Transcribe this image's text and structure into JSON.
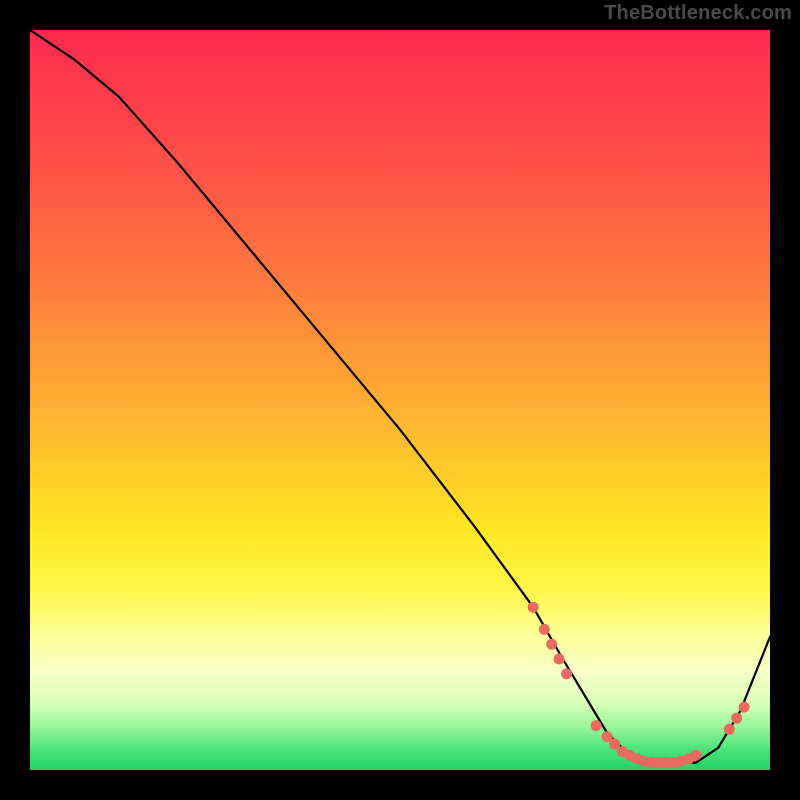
{
  "watermark": "TheBottleneck.com",
  "colors": {
    "curve": "#000000",
    "marker": "#e96a5f",
    "frame": "#000000"
  },
  "chart_data": {
    "type": "line",
    "title": "",
    "xlabel": "",
    "ylabel": "",
    "xlim": [
      0,
      100
    ],
    "ylim": [
      0,
      100
    ],
    "grid": false,
    "legend": false,
    "series": [
      {
        "name": "bottleneck-curve",
        "x": [
          0,
          6,
          12,
          20,
          30,
          40,
          50,
          60,
          68,
          72,
          75,
          78,
          81,
          84,
          87,
          90,
          93,
          96,
          100
        ],
        "y": [
          100,
          96,
          91,
          82,
          70,
          58,
          46,
          33,
          22,
          15,
          10,
          5,
          2,
          1,
          1,
          1,
          3,
          8,
          18
        ]
      }
    ],
    "markers": [
      {
        "x": 68.0,
        "y": 22.0
      },
      {
        "x": 69.5,
        "y": 19.0
      },
      {
        "x": 70.5,
        "y": 17.0
      },
      {
        "x": 71.5,
        "y": 15.0
      },
      {
        "x": 72.5,
        "y": 13.0
      },
      {
        "x": 76.5,
        "y": 6.0
      },
      {
        "x": 78.0,
        "y": 4.5
      },
      {
        "x": 79.0,
        "y": 3.5
      },
      {
        "x": 80.0,
        "y": 2.5
      },
      {
        "x": 81.0,
        "y": 2.0
      },
      {
        "x": 82.0,
        "y": 1.5
      },
      {
        "x": 83.0,
        "y": 1.2
      },
      {
        "x": 84.0,
        "y": 1.0
      },
      {
        "x": 85.0,
        "y": 1.0
      },
      {
        "x": 86.0,
        "y": 1.0
      },
      {
        "x": 87.0,
        "y": 1.0
      },
      {
        "x": 88.0,
        "y": 1.2
      },
      {
        "x": 89.0,
        "y": 1.5
      },
      {
        "x": 90.0,
        "y": 2.0
      },
      {
        "x": 94.5,
        "y": 5.5
      },
      {
        "x": 95.5,
        "y": 7.0
      },
      {
        "x": 96.5,
        "y": 8.5
      }
    ]
  }
}
